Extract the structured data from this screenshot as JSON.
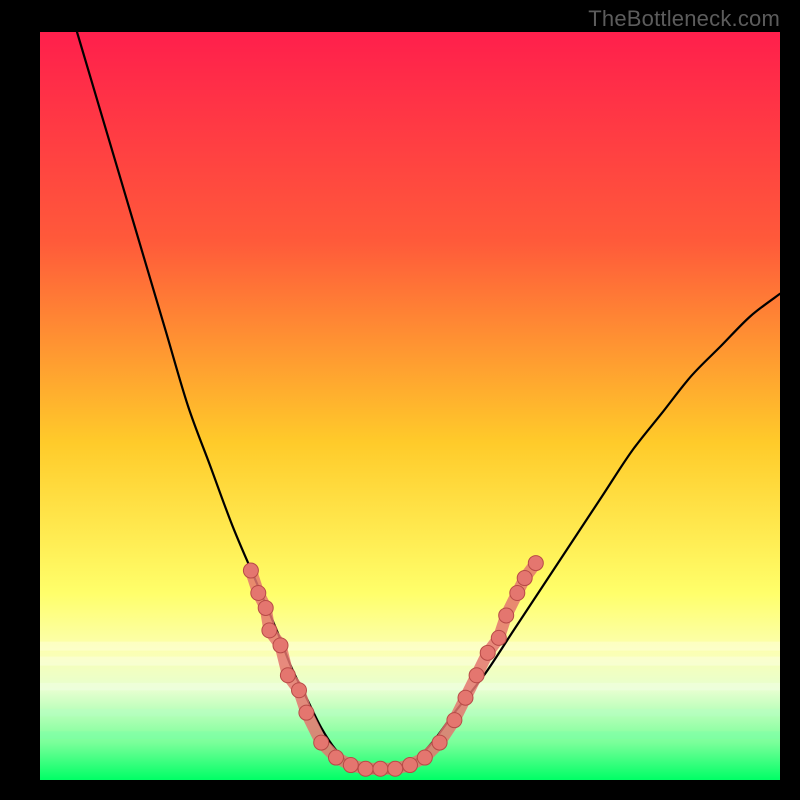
{
  "watermark": {
    "text": "TheBottleneck.com"
  },
  "colors": {
    "black": "#000000",
    "curve": "#000000",
    "marker_fill": "#e4766f",
    "marker_stroke": "#b84a47",
    "lime_band": "#00ff66"
  },
  "chart_data": {
    "type": "line",
    "title": "",
    "xlabel": "",
    "ylabel": "",
    "xlim": [
      0,
      100
    ],
    "ylim": [
      0,
      100
    ],
    "grid": false,
    "legend": false,
    "gradient_stops": [
      {
        "pct": 0,
        "color": "#ff1f4c"
      },
      {
        "pct": 28,
        "color": "#ff5a3a"
      },
      {
        "pct": 55,
        "color": "#ffcb2a"
      },
      {
        "pct": 75,
        "color": "#ffff6a"
      },
      {
        "pct": 83,
        "color": "#fbffb4"
      },
      {
        "pct": 88,
        "color": "#e6ffd0"
      },
      {
        "pct": 95,
        "color": "#7aff9a"
      },
      {
        "pct": 100,
        "color": "#00ff66"
      }
    ],
    "curve_left": {
      "x": [
        5,
        8,
        11,
        14,
        17,
        20,
        23,
        26,
        29,
        32,
        34,
        36,
        38,
        40,
        42
      ],
      "y": [
        100,
        90,
        80,
        70,
        60,
        50,
        42,
        34,
        27,
        20,
        15,
        11,
        7,
        4,
        2
      ]
    },
    "curve_floor": {
      "x": [
        42,
        44,
        46,
        48,
        50
      ],
      "y": [
        2,
        1,
        1,
        1,
        2
      ]
    },
    "curve_right": {
      "x": [
        50,
        53,
        56,
        60,
        64,
        68,
        72,
        76,
        80,
        84,
        88,
        92,
        96,
        100
      ],
      "y": [
        2,
        5,
        9,
        14,
        20,
        26,
        32,
        38,
        44,
        49,
        54,
        58,
        62,
        65
      ]
    },
    "markers": [
      {
        "x": 28.5,
        "y": 28
      },
      {
        "x": 29.5,
        "y": 25
      },
      {
        "x": 30.5,
        "y": 23
      },
      {
        "x": 31,
        "y": 20
      },
      {
        "x": 32.5,
        "y": 18
      },
      {
        "x": 33.5,
        "y": 14
      },
      {
        "x": 35,
        "y": 12
      },
      {
        "x": 36,
        "y": 9
      },
      {
        "x": 38,
        "y": 5
      },
      {
        "x": 40,
        "y": 3
      },
      {
        "x": 42,
        "y": 2
      },
      {
        "x": 44,
        "y": 1.5
      },
      {
        "x": 46,
        "y": 1.5
      },
      {
        "x": 48,
        "y": 1.5
      },
      {
        "x": 50,
        "y": 2
      },
      {
        "x": 52,
        "y": 3
      },
      {
        "x": 54,
        "y": 5
      },
      {
        "x": 56,
        "y": 8
      },
      {
        "x": 57.5,
        "y": 11
      },
      {
        "x": 59,
        "y": 14
      },
      {
        "x": 60.5,
        "y": 17
      },
      {
        "x": 62,
        "y": 19
      },
      {
        "x": 63,
        "y": 22
      },
      {
        "x": 64.5,
        "y": 25
      },
      {
        "x": 65.5,
        "y": 27
      },
      {
        "x": 67,
        "y": 29
      }
    ]
  }
}
